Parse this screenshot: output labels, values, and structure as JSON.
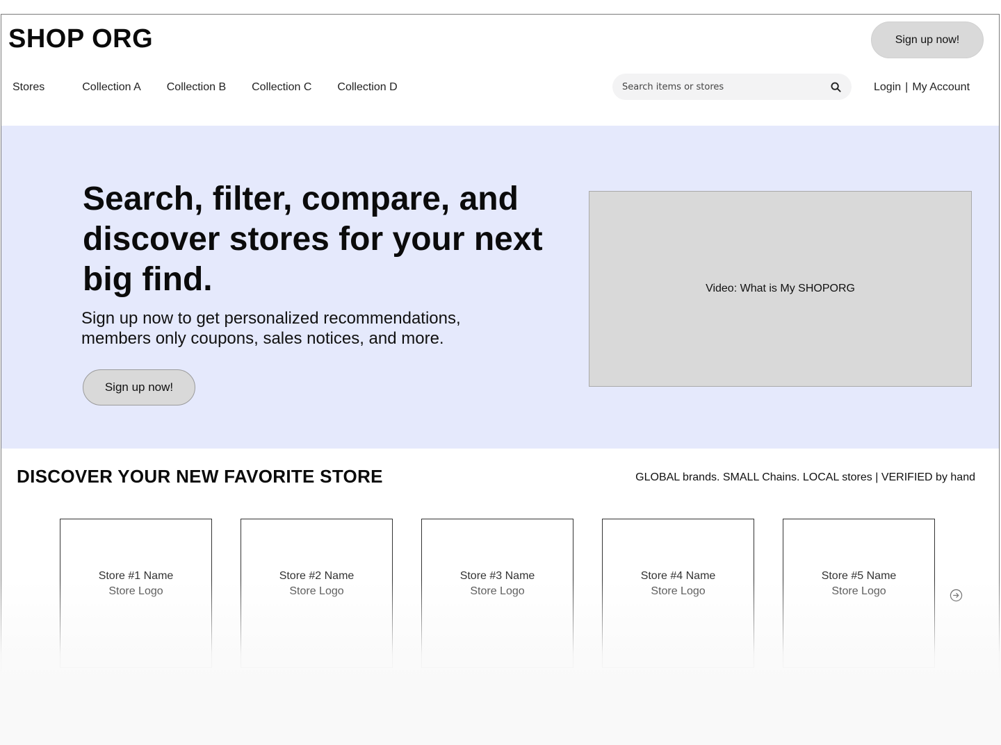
{
  "header": {
    "logo": "SHOP ORG",
    "signup_label": "Sign up now!",
    "nav": [
      "Stores",
      "Collection A",
      "Collection B",
      "Collection C",
      "Collection D"
    ],
    "search": {
      "placeholder": "Search items or stores",
      "icon": "search-icon"
    },
    "login_label": "Login",
    "separator": "|",
    "account_label": "My Account"
  },
  "hero": {
    "title": "Search, filter, compare, and discover stores for your next big find.",
    "subtitle": "Sign up now to get personalized recommendations, members only coupons, sales notices, and more.",
    "signup_label": "Sign up now!",
    "video_label": "Video: What is My SHOPORG",
    "background_color": "#e5e9fc"
  },
  "discover": {
    "title": "DISCOVER YOUR NEW FAVORITE STORE",
    "tagline": "GLOBAL brands. SMALL Chains. LOCAL stores | VERIFIED by hand",
    "stores": [
      {
        "name": "Store #1 Name",
        "logo": "Store Logo"
      },
      {
        "name": "Store #2 Name",
        "logo": "Store Logo"
      },
      {
        "name": "Store #3 Name",
        "logo": "Store Logo"
      },
      {
        "name": "Store #4 Name",
        "logo": "Store Logo"
      },
      {
        "name": "Store #5 Name",
        "logo": "Store Logo"
      }
    ],
    "next_icon": "arrow-right-circle-icon"
  }
}
